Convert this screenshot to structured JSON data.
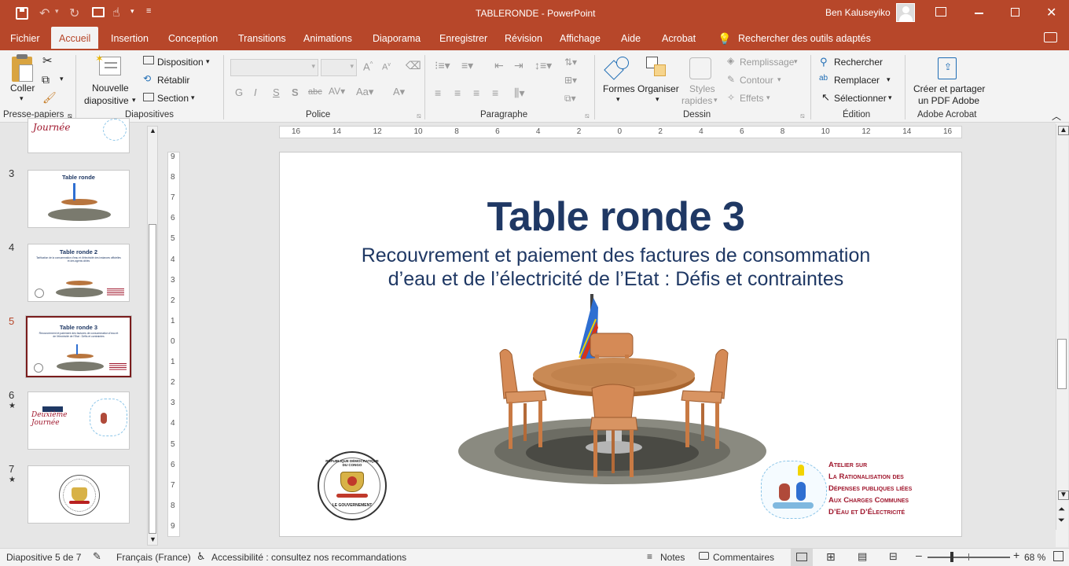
{
  "titlebar": {
    "doc_title": "TABLERONDE  -  PowerPoint",
    "user_name": "Ben Kaluseyiko"
  },
  "tabs": [
    "Fichier",
    "Accueil",
    "Insertion",
    "Conception",
    "Transitions",
    "Animations",
    "Diaporama",
    "Enregistrer",
    "Révision",
    "Affichage",
    "Aide",
    "Acrobat"
  ],
  "search_tools": "Rechercher des outils adaptés",
  "ribbon": {
    "clipboard": {
      "paste": "Coller",
      "group": "Presse-papiers"
    },
    "slides": {
      "new_slide_1": "Nouvelle",
      "new_slide_2": "diapositive",
      "layout": "Disposition",
      "reset": "Rétablir",
      "section": "Section",
      "group": "Diapositives"
    },
    "font": {
      "bold": "G",
      "italic": "I",
      "underline": "S",
      "shadow": "S",
      "strike": "abc",
      "group": "Police"
    },
    "paragraph": {
      "group": "Paragraphe"
    },
    "drawing": {
      "shapes": "Formes",
      "arrange": "Organiser",
      "quick_styles_1": "Styles",
      "quick_styles_2": "rapides",
      "fill": "Remplissage",
      "outline": "Contour",
      "effects": "Effets",
      "group": "Dessin"
    },
    "editing": {
      "find": "Rechercher",
      "replace": "Remplacer",
      "select": "Sélectionner",
      "group": "Édition"
    },
    "acrobat": {
      "create_1": "Créer et partager",
      "create_2": "un PDF Adobe",
      "group": "Adobe Acrobat"
    }
  },
  "thumbnails": [
    {
      "num": "3",
      "star": "",
      "title": "Table ronde",
      "sub": ""
    },
    {
      "num": "4",
      "star": "",
      "title": "Table ronde 2",
      "sub": "Tarification de la consommation d'eau et d'électricité des instances officielles et des agents ciblés"
    },
    {
      "num": "5",
      "star": "",
      "title": "Table ronde 3",
      "sub": "Recouvrement et paiement des factures de consommation d'eau et de l'électricité de l'Etat : Défis et contraintes"
    },
    {
      "num": "6",
      "star": "★",
      "title": "Deuxième Journée",
      "sub": ""
    },
    {
      "num": "7",
      "star": "★",
      "title": "",
      "sub": ""
    }
  ],
  "slide": {
    "title": "Table ronde 3",
    "subtitle_line1": "Recouvrement et paiement des factures de consommation",
    "subtitle_line2": "d’eau et de l’électricité de l’Etat : Défis et contraintes",
    "seal_top": "RÉPUBLIQUE DÉMOCRATIQUE DU CONGO",
    "seal_bottom": "LE GOUVERNEMENT",
    "atelier": [
      "Atelier sur",
      "La Rationalisation des",
      "Dépenses publiques liées",
      "Aux Charges Communes",
      "D’Eau et D’Électricité"
    ]
  },
  "ruler_h": [
    "16",
    "14",
    "12",
    "10",
    "8",
    "6",
    "4",
    "2",
    "0",
    "2",
    "4",
    "6",
    "8",
    "10",
    "12",
    "14",
    "16"
  ],
  "ruler_v": [
    "9",
    "8",
    "7",
    "6",
    "5",
    "4",
    "3",
    "2",
    "1",
    "0",
    "1",
    "2",
    "3",
    "4",
    "5",
    "6",
    "7",
    "8",
    "9"
  ],
  "status": {
    "slide_count": "Diapositive 5 de 7",
    "language": "Français (France)",
    "accessibility": "Accessibilité : consultez nos recommandations",
    "notes": "Notes",
    "comments": "Commentaires",
    "zoom": "68 %"
  },
  "colors": {
    "accent": "#b7472a",
    "title": "#1f3864",
    "atelier": "#a0182e"
  }
}
